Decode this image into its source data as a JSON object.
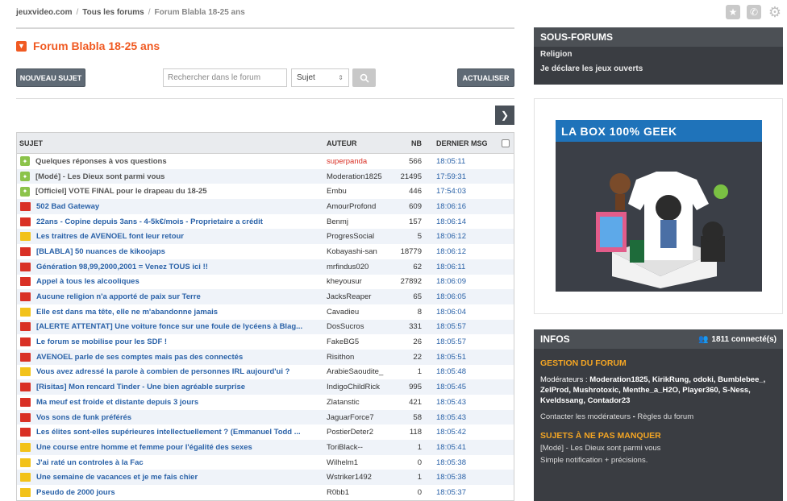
{
  "breadcrumb": {
    "site": "jeuxvideo.com",
    "sep": "/",
    "all": "Tous les forums",
    "current": "Forum Blabla 18-25 ans"
  },
  "page": {
    "title": "Forum Blabla 18-25 ans"
  },
  "toolbar": {
    "new_topic": "NOUVEAU SUJET",
    "search_placeholder": "Rechercher dans le forum",
    "search_scope": "Sujet",
    "refresh": "ACTUALISER"
  },
  "table": {
    "headers": {
      "subject": "SUJET",
      "author": "AUTEUR",
      "nb": "NB",
      "last": "DERNIER MSG"
    },
    "rows": [
      {
        "icon": "pin",
        "subject": "Quelques réponses à vos questions",
        "author": "superpanda",
        "nb": "566",
        "time": "18:05:11"
      },
      {
        "icon": "pin",
        "subject": "[Modé] - Les Dieux sont parmi vous",
        "author": "Moderation1825",
        "nb": "21495",
        "time": "17:59:31"
      },
      {
        "icon": "pin",
        "subject": "[Officiel] VOTE FINAL pour le drapeau du 18-25",
        "author": "Embu",
        "nb": "446",
        "time": "17:54:03"
      },
      {
        "icon": "red",
        "subject": "502 Bad Gateway",
        "author": "AmourProfond",
        "nb": "609",
        "time": "18:06:16"
      },
      {
        "icon": "red",
        "subject": "22ans - Copine depuis 3ans - 4-5k€/mois - Proprietaire a crédit",
        "author": "Benmj",
        "nb": "157",
        "time": "18:06:14"
      },
      {
        "icon": "yellow",
        "subject": "Les traitres de AVENOEL font leur retour",
        "author": "ProgresSocial",
        "nb": "5",
        "time": "18:06:12"
      },
      {
        "icon": "red",
        "subject": "[BLABLA] 50 nuances de kikoojaps",
        "author": "Kobayashi-san",
        "nb": "18779",
        "time": "18:06:12"
      },
      {
        "icon": "red",
        "subject": "Génération 98,99,2000,2001 = Venez TOUS ici !!",
        "author": "mrfindus020",
        "nb": "62",
        "time": "18:06:11"
      },
      {
        "icon": "red",
        "subject": "Appel à tous les alcooliques",
        "author": "kheyousur",
        "nb": "27892",
        "time": "18:06:09"
      },
      {
        "icon": "red",
        "subject": "Aucune religion n'a apporté de paix sur Terre",
        "author": "JacksReaper",
        "nb": "65",
        "time": "18:06:05"
      },
      {
        "icon": "yellow",
        "subject": "Elle est dans ma tête, elle ne m'abandonne jamais",
        "author": "Cavadieu",
        "nb": "8",
        "time": "18:06:04"
      },
      {
        "icon": "red",
        "subject": "[ALERTE ATTENTAT] Une voiture fonce sur une foule de lycéens à Blag...",
        "author": "DosSucros",
        "nb": "331",
        "time": "18:05:57"
      },
      {
        "icon": "red",
        "subject": "Le forum se mobilise pour les SDF !",
        "author": "FakeBG5",
        "nb": "26",
        "time": "18:05:57"
      },
      {
        "icon": "red",
        "subject": "AVENOEL parle de ses comptes mais pas des connectés",
        "author": "Risithon",
        "nb": "22",
        "time": "18:05:51"
      },
      {
        "icon": "yellow",
        "subject": "Vous avez adressé la parole à combien de personnes IRL aujourd'ui ?",
        "author": "ArabieSaoudite_",
        "nb": "1",
        "time": "18:05:48"
      },
      {
        "icon": "red",
        "subject": "[Risitas] Mon rencard Tinder - Une bien agréable surprise",
        "author": "IndigoChildRick",
        "nb": "995",
        "time": "18:05:45"
      },
      {
        "icon": "red",
        "subject": "Ma meuf est froide et distante depuis 3 jours",
        "author": "Zlatanstic",
        "nb": "421",
        "time": "18:05:43"
      },
      {
        "icon": "red",
        "subject": "Vos sons de funk préférés",
        "author": "JaguarForce7",
        "nb": "58",
        "time": "18:05:43"
      },
      {
        "icon": "red",
        "subject": "Les élites sont-elles supérieures intellectuellement ? (Emmanuel Todd ...",
        "author": "PostierDeter2",
        "nb": "118",
        "time": "18:05:42"
      },
      {
        "icon": "yellow",
        "subject": "Une course entre homme et femme pour l'égalité des sexes",
        "author": "ToriBlack--",
        "nb": "1",
        "time": "18:05:41"
      },
      {
        "icon": "yellow",
        "subject": "J'ai raté un controles à la Fac",
        "author": "Wilhelm1",
        "nb": "0",
        "time": "18:05:38"
      },
      {
        "icon": "yellow",
        "subject": "Une semaine de vacances et je me fais chier",
        "author": "Wstriker1492",
        "nb": "1",
        "time": "18:05:38"
      },
      {
        "icon": "yellow",
        "subject": "Pseudo de 2000 jours",
        "author": "R0bb1",
        "nb": "0",
        "time": "18:05:37"
      }
    ]
  },
  "subforums": {
    "title": "SOUS-FORUMS",
    "items": [
      "Religion",
      "Je déclare les jeux ouverts"
    ]
  },
  "ad": {
    "banner": "LA BOX 100% GEEK"
  },
  "infos": {
    "title": "INFOS",
    "online": "1811 connecté(s)",
    "gestion_title": "GESTION DU FORUM",
    "mods_label": "Modérateurs :",
    "mods_list": "Moderation1825, KirikRung, odoki, Bumblebee_, ZelProd, Mushrotoxic, Menthe_a_H2O, Player360, S-Ness, Kveldssang, Contador23",
    "contact": "Contacter les modérateurs",
    "rules": "Règles du forum",
    "missing_title": "SUJETS À NE PAS MANQUER",
    "missing": [
      "[Modé] - Les Dieux sont parmi vous",
      "Simple notification + précisions."
    ]
  },
  "colors": {
    "accent": "#f05a22",
    "link": "#2a62a8",
    "panel": "#3a3d42",
    "gold": "#f5a623"
  }
}
